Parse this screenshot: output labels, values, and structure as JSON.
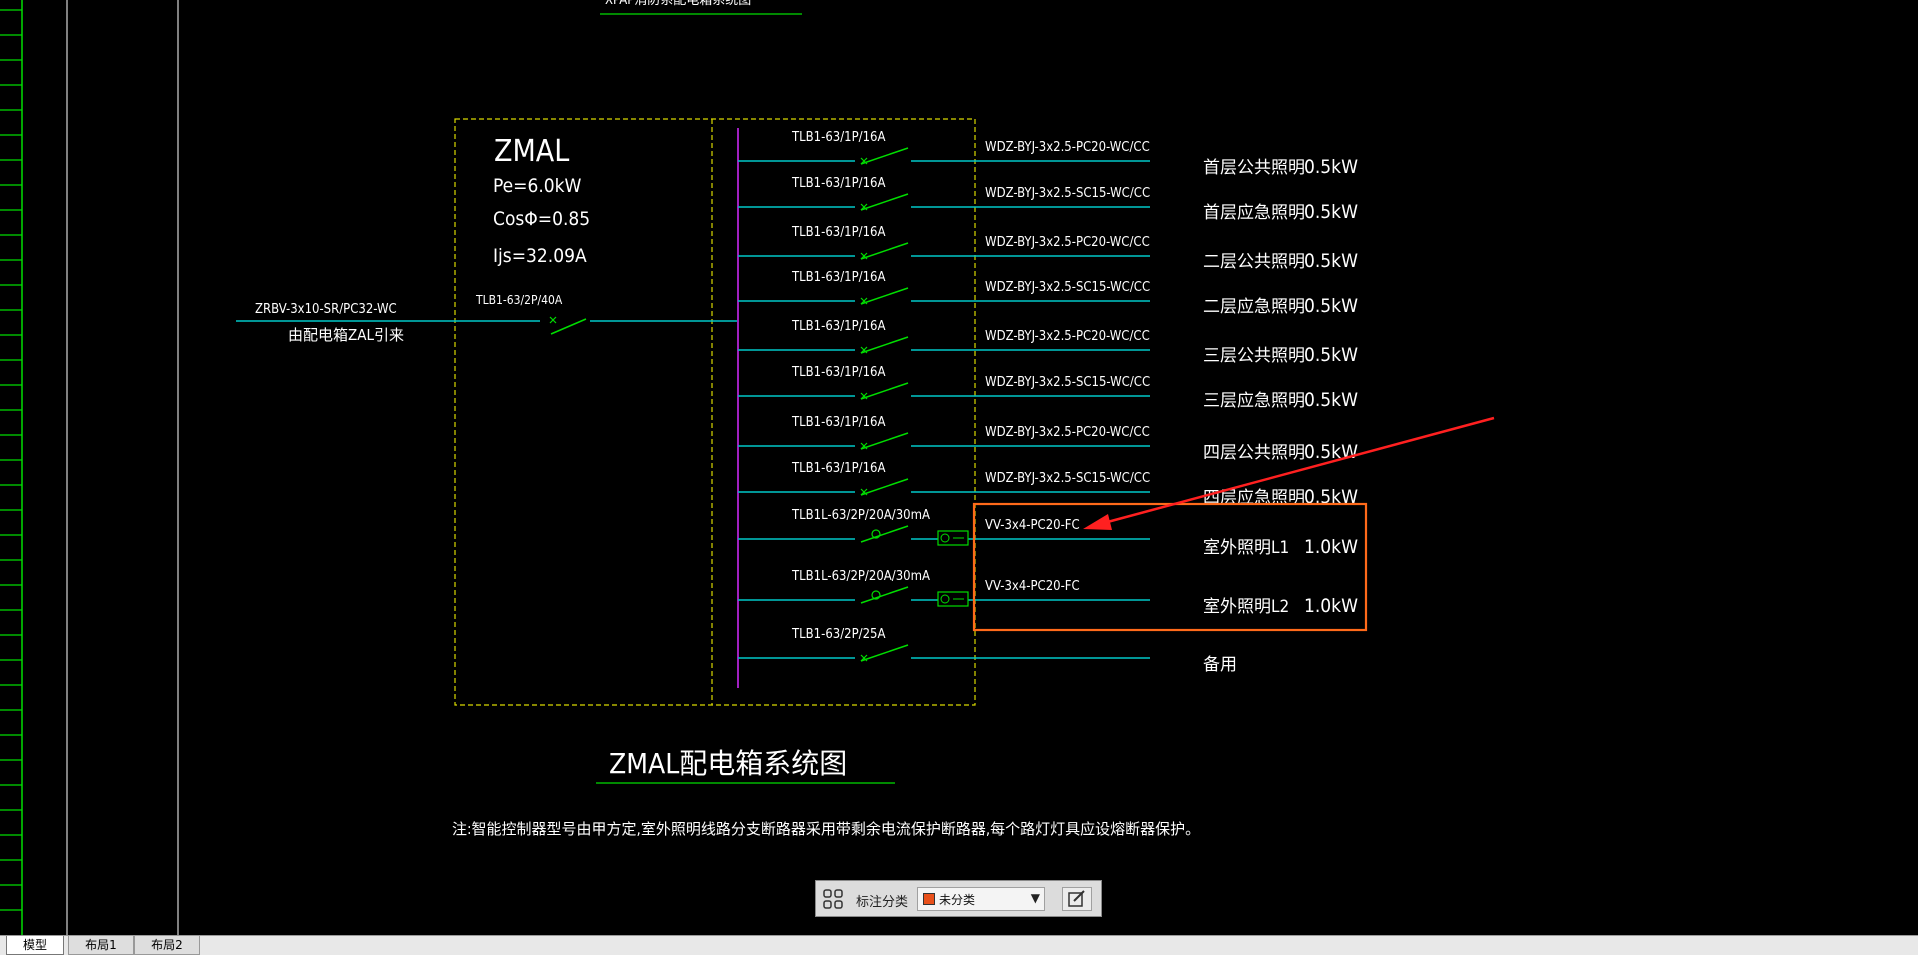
{
  "drawing": {
    "top_title_partial": "XPAP消防系配电箱系统图",
    "panel_name": "ZMAL",
    "pe": "Pe=6.0kW",
    "cos": "CosΦ=0.85",
    "ijs": "Ijs=32.09A",
    "incoming_cable": "ZRBV-3x10-SR/PC32-WC",
    "incoming_source": "由配电箱ZAL引来",
    "main_breaker": "TLB1-63/2P/40A",
    "circuits": [
      {
        "breaker": "TLB1-63/1P/16A",
        "cable": "WDZ-BYJ-3x2.5-PC20-WC/CC",
        "load": "首层公共照明",
        "power": "0.5kW"
      },
      {
        "breaker": "TLB1-63/1P/16A",
        "cable": "WDZ-BYJ-3x2.5-SC15-WC/CC",
        "load": "首层应急照明",
        "power": "0.5kW"
      },
      {
        "breaker": "TLB1-63/1P/16A",
        "cable": "WDZ-BYJ-3x2.5-PC20-WC/CC",
        "load": "二层公共照明",
        "power": "0.5kW"
      },
      {
        "breaker": "TLB1-63/1P/16A",
        "cable": "WDZ-BYJ-3x2.5-SC15-WC/CC",
        "load": "二层应急照明",
        "power": "0.5kW"
      },
      {
        "breaker": "TLB1-63/1P/16A",
        "cable": "WDZ-BYJ-3x2.5-PC20-WC/CC",
        "load": "三层公共照明",
        "power": "0.5kW"
      },
      {
        "breaker": "TLB1-63/1P/16A",
        "cable": "WDZ-BYJ-3x2.5-SC15-WC/CC",
        "load": "三层应急照明",
        "power": "0.5kW"
      },
      {
        "breaker": "TLB1-63/1P/16A",
        "cable": "WDZ-BYJ-3x2.5-PC20-WC/CC",
        "load": "四层公共照明",
        "power": "0.5kW"
      },
      {
        "breaker": "TLB1-63/1P/16A",
        "cable": "WDZ-BYJ-3x2.5-SC15-WC/CC",
        "load": "四层应急照明",
        "power": "0.5kW"
      },
      {
        "breaker": "TLB1L-63/2P/20A/30mA",
        "cable": "VV-3x4-PC20-FC",
        "load": "室外照明L1",
        "power": "1.0kW"
      },
      {
        "breaker": "TLB1L-63/2P/20A/30mA",
        "cable": "VV-3x4-PC20-FC",
        "load": "室外照明L2",
        "power": "1.0kW"
      },
      {
        "breaker": "TLB1-63/2P/25A",
        "cable": "",
        "load": "备用",
        "power": ""
      }
    ],
    "diagram_title": "ZMAL配电箱系统图",
    "note": "注:智能控制器型号由甲方定,室外照明线路分支断路器采用带剩余电流保护断路器,每个路灯灯具应设熔断器保护。"
  },
  "layout_tabs": [
    {
      "label": "模型"
    },
    {
      "label": "布局1"
    },
    {
      "label": "布局2"
    }
  ],
  "toolbar": {
    "label": "标注分类",
    "selected": "未分类",
    "swatch_color": "#e8501a"
  },
  "colors": {
    "background": "#000000",
    "text": "#ffffff",
    "box_dashed": "#d8d800",
    "busbar": "#a020c0",
    "feeder": "#00c8c8",
    "breaker": "#00dd00",
    "highlight": "#ff6a1a",
    "arrow": "#ff2020"
  }
}
